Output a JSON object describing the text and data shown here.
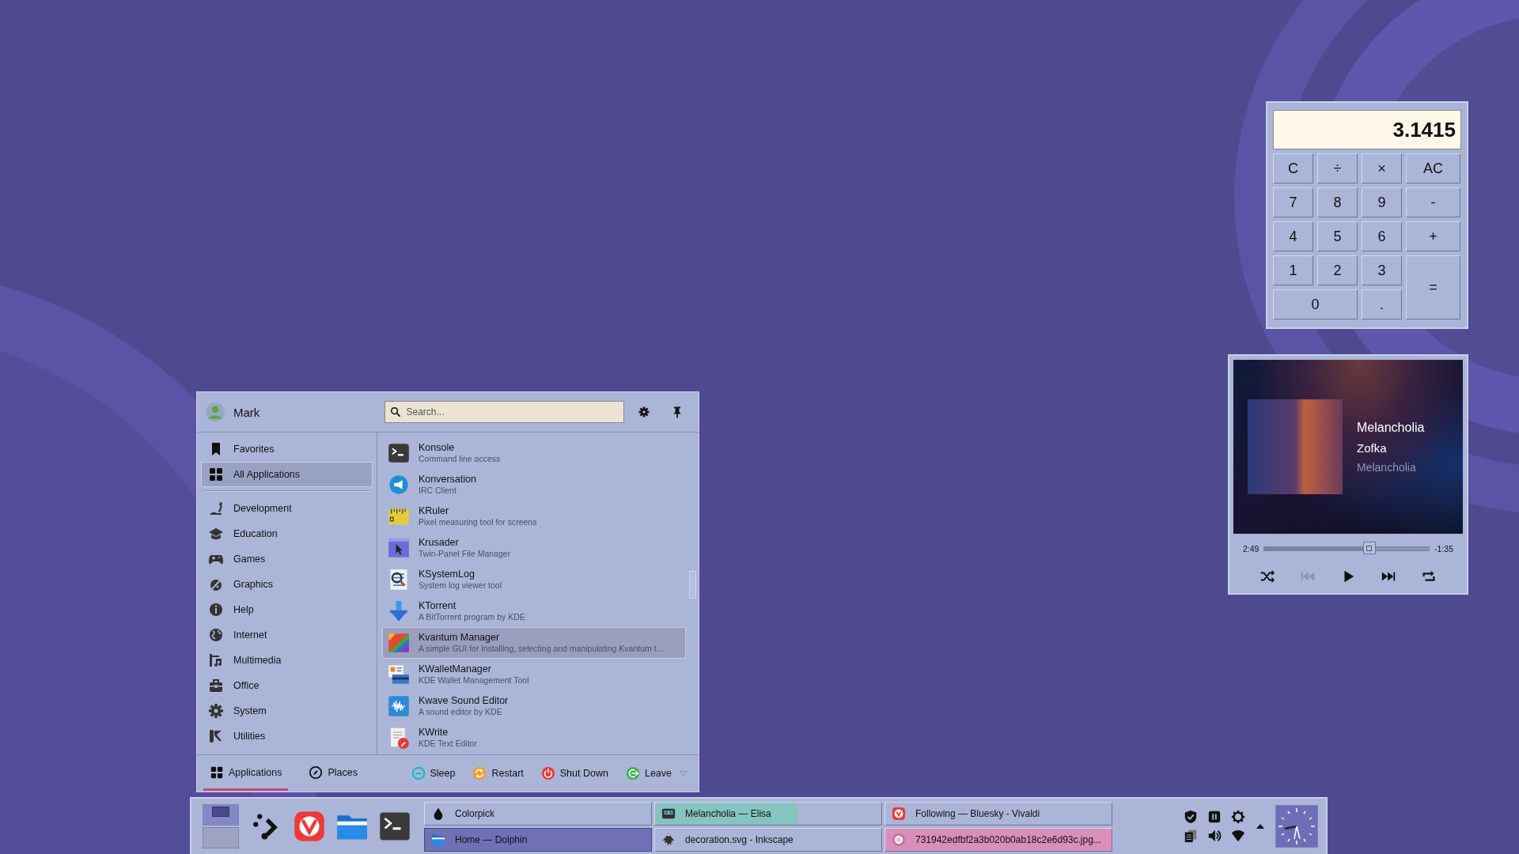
{
  "launcher": {
    "user": "Mark",
    "search": {
      "placeholder": "Search..."
    },
    "sections": [
      {
        "label": "Favorites",
        "selected": false
      },
      {
        "label": "All Applications",
        "selected": true
      }
    ],
    "categories": [
      {
        "label": "Development",
        "selected": false
      },
      {
        "label": "Education",
        "selected": false
      },
      {
        "label": "Games",
        "selected": false
      },
      {
        "label": "Graphics",
        "selected": false
      },
      {
        "label": "Help",
        "selected": false
      },
      {
        "label": "Internet",
        "selected": false
      },
      {
        "label": "Multimedia",
        "selected": false
      },
      {
        "label": "Office",
        "selected": false
      },
      {
        "label": "System",
        "selected": false
      },
      {
        "label": "Utilities",
        "selected": false
      }
    ],
    "apps": [
      {
        "name": "Konsole",
        "description": "Command line access",
        "selected": false
      },
      {
        "name": "Konversation",
        "description": "IRC Client",
        "selected": false
      },
      {
        "name": "KRuler",
        "description": "Pixel measuring tool for screens",
        "selected": false
      },
      {
        "name": "Krusader",
        "description": "Twin-Panel File Manager",
        "selected": false
      },
      {
        "name": "KSystemLog",
        "description": "System log viewer tool",
        "selected": false
      },
      {
        "name": "KTorrent",
        "description": "A BitTorrent program by KDE",
        "selected": false
      },
      {
        "name": "Kvantum Manager",
        "description": "A simple GUI for installing, selecting and manipulating Kvantum t...",
        "selected": true
      },
      {
        "name": "KWalletManager",
        "description": "KDE Wallet Management Tool",
        "selected": false
      },
      {
        "name": "Kwave Sound Editor",
        "description": "A sound editor by KDE",
        "selected": false
      },
      {
        "name": "KWrite",
        "description": "KDE Text Editor",
        "selected": false
      }
    ],
    "tabs": [
      {
        "label": "Applications",
        "selected": true
      },
      {
        "label": "Places",
        "selected": false
      }
    ],
    "actions": [
      {
        "kind": "sleep",
        "label": "Sleep"
      },
      {
        "kind": "restart",
        "label": "Restart"
      },
      {
        "kind": "shutdown",
        "label": "Shut Down"
      },
      {
        "kind": "leave",
        "label": "Leave"
      }
    ]
  },
  "calculator": {
    "display": "3.1415",
    "keys": [
      "C",
      "÷",
      "×",
      "AC",
      "7",
      "8",
      "9",
      "-",
      "4",
      "5",
      "6",
      "+",
      "1",
      "2",
      "3",
      "=",
      "0",
      "."
    ]
  },
  "player": {
    "title": "Melancholia",
    "artist": "Zofka",
    "album": "Melancholia",
    "elapsed": "2:49",
    "remaining": "-1:35",
    "level": 0.64,
    "controls": [
      {
        "kind": "shuffle",
        "disabled": false
      },
      {
        "kind": "previous",
        "disabled": true
      },
      {
        "kind": "play",
        "disabled": false
      },
      {
        "kind": "next",
        "disabled": false
      },
      {
        "kind": "repeat",
        "disabled": false
      }
    ]
  },
  "taskbar": {
    "pager": [
      {
        "selected": true
      },
      {
        "selected": false
      }
    ],
    "launchers": [
      {
        "kind": "menu"
      },
      {
        "kind": "vivaldi"
      },
      {
        "kind": "folder"
      },
      {
        "kind": "terminal"
      }
    ],
    "tasks": [
      {
        "kind": "dropper",
        "title": "Colorpick",
        "selected": false,
        "attention": false
      },
      {
        "kind": "folder",
        "title": "Home — Dolphin",
        "selected": true,
        "attention": false
      },
      {
        "kind": "cassette",
        "title": "Melancholia — Elisa",
        "selected": false,
        "attention": false,
        "level": 0.63
      },
      {
        "kind": "inkscape",
        "title": "decoration.svg - Inkscape",
        "selected": false,
        "attention": false
      },
      {
        "kind": "vivaldi",
        "title": "Following — Bluesky - Vivaldi",
        "selected": false,
        "attention": false
      },
      {
        "kind": "image",
        "title": "731942edfbf2a3b020b0ab18c2e6d93c.jpg...",
        "selected": false,
        "attention": true
      }
    ]
  }
}
